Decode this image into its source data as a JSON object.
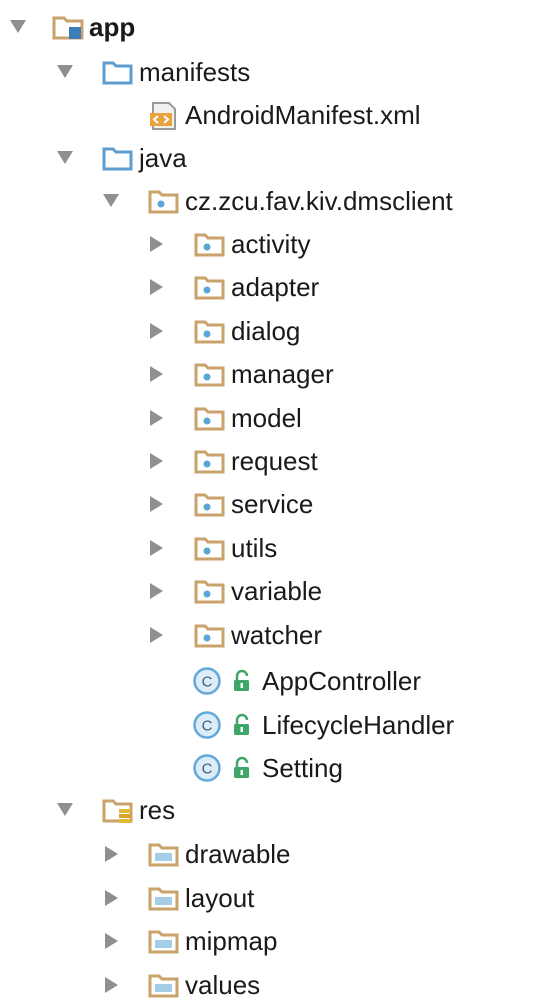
{
  "tree": {
    "app": {
      "label": "app",
      "icon": "module-folder-icon"
    },
    "manifests": {
      "label": "manifests",
      "icon": "source-root-folder-icon"
    },
    "manifest_file": {
      "label": "AndroidManifest.xml",
      "icon": "xml-file-icon"
    },
    "java": {
      "label": "java",
      "icon": "source-root-folder-icon"
    },
    "package": {
      "label": "cz.zcu.fav.kiv.dmsclient",
      "icon": "package-folder-icon"
    },
    "subpackages": [
      {
        "label": "activity"
      },
      {
        "label": "adapter"
      },
      {
        "label": "dialog"
      },
      {
        "label": "manager"
      },
      {
        "label": "model"
      },
      {
        "label": "request"
      },
      {
        "label": "service"
      },
      {
        "label": "utils"
      },
      {
        "label": "variable"
      },
      {
        "label": "watcher"
      }
    ],
    "classes": [
      {
        "label": "AppController"
      },
      {
        "label": "LifecycleHandler"
      },
      {
        "label": "Setting"
      }
    ],
    "res": {
      "label": "res",
      "icon": "resources-folder-icon"
    },
    "res_folders": [
      {
        "label": "drawable"
      },
      {
        "label": "layout"
      },
      {
        "label": "mipmap"
      },
      {
        "label": "values"
      }
    ]
  },
  "colors": {
    "folder_tan": "#c9a36b",
    "source_blue": "#5c9ed1",
    "package_dot": "#5aa6d6",
    "class_circle": "#62a8d9",
    "lock_green": "#3fa66a",
    "arrow_gray": "#8f8f8f"
  }
}
